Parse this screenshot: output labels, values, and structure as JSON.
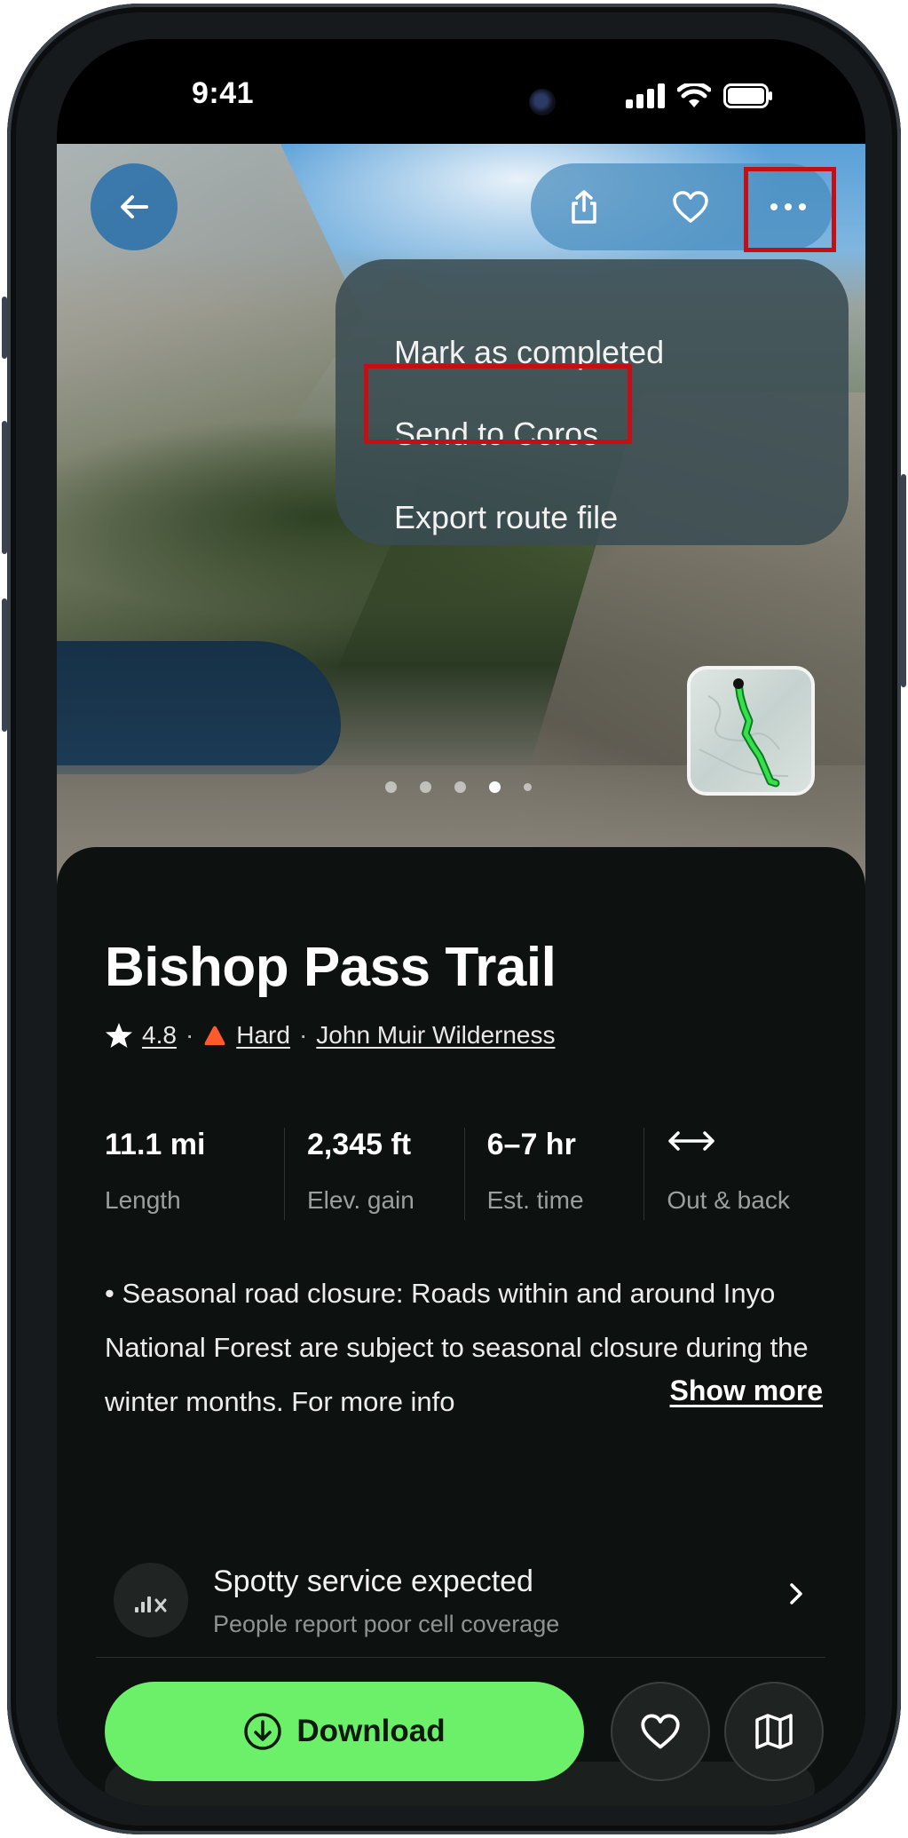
{
  "status_bar": {
    "time": "9:41"
  },
  "top_actions": {
    "back_icon": "arrow-left-icon",
    "share_icon": "share-icon",
    "favorite_icon": "heart-icon",
    "more_icon": "more-horizontal-icon"
  },
  "menu": {
    "items": [
      {
        "label": "Mark as completed"
      },
      {
        "label": "Send to Coros"
      },
      {
        "label": "Export route file"
      }
    ]
  },
  "carousel": {
    "total": 5,
    "active_index": 3
  },
  "trail": {
    "title": "Bishop Pass Trail",
    "rating": "4.8",
    "difficulty": "Hard",
    "difficulty_color": "#ff5a2a",
    "area": "John Muir Wilderness",
    "separator": "·"
  },
  "stats": [
    {
      "value": "11.1 mi",
      "label": "Length"
    },
    {
      "value": "2,345 ft",
      "label": "Elev. gain"
    },
    {
      "value": "6–7 hr",
      "label": "Est. time"
    },
    {
      "value": "",
      "label": "Out & back",
      "icon": "arrow-left-right-icon"
    }
  ],
  "description": {
    "text": "• Seasonal road closure: Roads within and around Inyo National Forest are subject to seasonal closure during the winter months. For more info",
    "show_more": "Show more"
  },
  "service": {
    "title": "Spotty service expected",
    "subtitle": "People report poor cell coverage"
  },
  "actions": {
    "download_label": "Download",
    "accent_color": "#6cf06a"
  }
}
